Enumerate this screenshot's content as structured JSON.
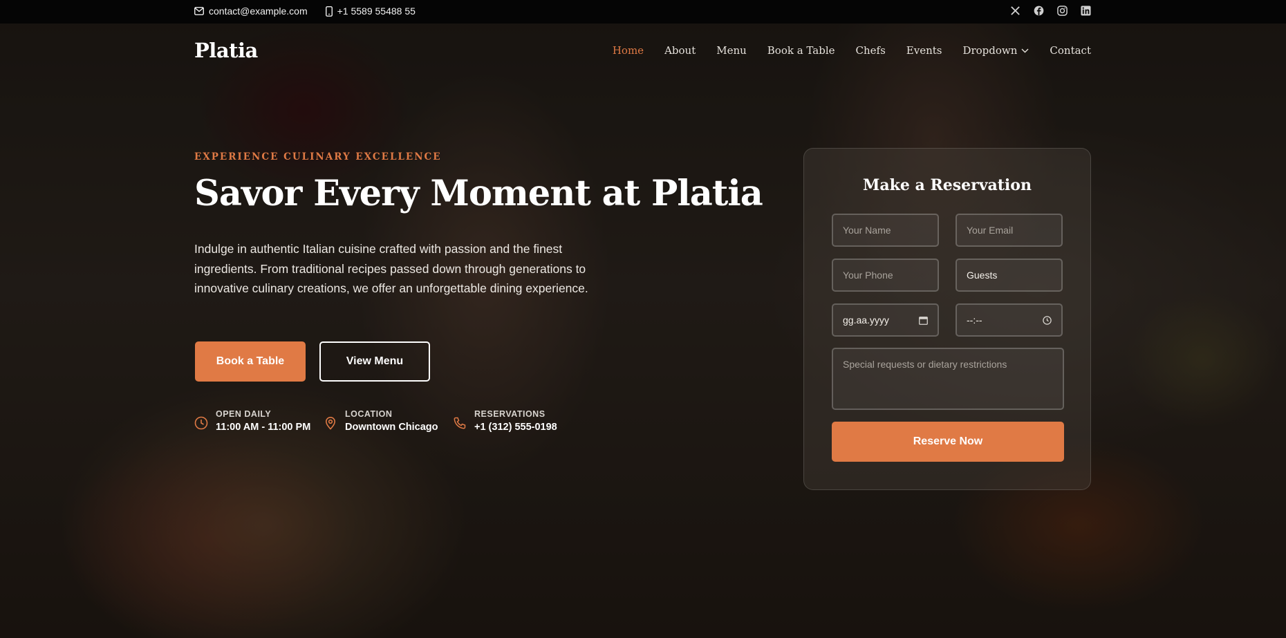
{
  "topbar": {
    "email": "contact@example.com",
    "phone": "+1 5589 55488 55",
    "social": [
      "x-icon",
      "facebook-icon",
      "instagram-icon",
      "linkedin-icon"
    ]
  },
  "header": {
    "logo": "Platia",
    "nav": [
      {
        "label": "Home",
        "active": true
      },
      {
        "label": "About"
      },
      {
        "label": "Menu"
      },
      {
        "label": "Book a Table"
      },
      {
        "label": "Chefs"
      },
      {
        "label": "Events"
      },
      {
        "label": "Dropdown",
        "has_caret": true
      },
      {
        "label": "Contact"
      }
    ]
  },
  "hero": {
    "eyebrow": "EXPERIENCE CULINARY EXCELLENCE",
    "title": "Savor Every Moment at Platia",
    "description": "Indulge in authentic Italian cuisine crafted with passion and the finest ingredients. From traditional recipes passed down through generations to innovative culinary creations, we offer an unforgettable dining experience.",
    "primary_button": "Book a Table",
    "secondary_button": "View Menu",
    "info": [
      {
        "label": "OPEN DAILY",
        "value": "11:00 AM - 11:00 PM",
        "icon": "clock-icon"
      },
      {
        "label": "LOCATION",
        "value": "Downtown Chicago",
        "icon": "map-pin-icon"
      },
      {
        "label": "RESERVATIONS",
        "value": "+1 (312) 555-0198",
        "icon": "phone-icon"
      }
    ]
  },
  "reservation": {
    "title": "Make a Reservation",
    "name_placeholder": "Your Name",
    "email_placeholder": "Your Email",
    "phone_placeholder": "Your Phone",
    "guests_value": "Guests",
    "date_value": "gg.aa.yyyy",
    "time_value": "--:--",
    "requests_placeholder": "Special requests or dietary restrictions",
    "submit": "Reserve Now"
  },
  "colors": {
    "accent": "#e07a45",
    "topbar_bg": "#050505"
  }
}
